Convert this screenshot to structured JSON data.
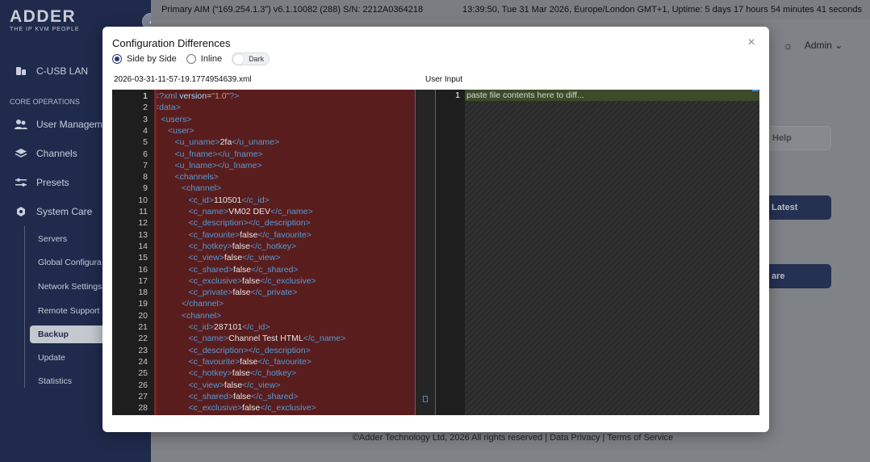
{
  "app": {
    "logo_name": "ADDER",
    "logo_tagline": "THE IP KVM PEOPLE",
    "status_left": "Primary AIM (“169.254.1.3”) v6.1.10082 (288) S/N: 2212A0364218",
    "status_right": "13:39:50, Tue 31 Mar 2026, Europe/London GMT+1, Uptime: 5 days 17 hours 54 minutes 41 seconds",
    "user_label": "Admin",
    "footer": "©Adder Technology Ltd, 2026 All rights reserved  |  Data Privacy  |  Terms of Service",
    "bg_button_1": "Help",
    "bg_button_2": "Latest",
    "bg_button_3": "are"
  },
  "sidebar": {
    "items": [
      {
        "label": "C-USB LAN",
        "icon": "usb-icon"
      },
      {
        "label": "User Managem",
        "icon": "users-icon"
      },
      {
        "label": "Channels",
        "icon": "layers-icon"
      },
      {
        "label": "Presets",
        "icon": "sliders-icon"
      },
      {
        "label": "System Care",
        "icon": "gear-icon"
      }
    ],
    "section_label": "CORE OPERATIONS",
    "sub_items": [
      "Servers",
      "Global Configura",
      "Network Settings",
      "Remote Support",
      "Backup",
      "Update",
      "Statistics"
    ]
  },
  "modal": {
    "title": "Configuration Differences",
    "options": {
      "side_by_side": "Side by Side",
      "inline": "Inline",
      "dark": "Dark"
    },
    "file_left": "2026-03-31-11-57-19.1774954639.xml",
    "file_right": "User Input",
    "right_line_number": "1",
    "right_placeholder": "paste file contents here to diff..."
  },
  "diff_lines": [
    {
      "n": "1",
      "i": 0,
      "h": "<span class=\"pi\">&lt;?xml</span> <span class=\"a\">version</span>=<span class=\"s\">\"1.0\"</span><span class=\"pi\">?&gt;</span>"
    },
    {
      "n": "2",
      "i": 0,
      "h": "<span class=\"t\">&lt;data&gt;</span>"
    },
    {
      "n": "3",
      "i": 1,
      "h": "<span class=\"t\">&lt;users&gt;</span>"
    },
    {
      "n": "4",
      "i": 2,
      "h": "<span class=\"t\">&lt;user&gt;</span>"
    },
    {
      "n": "5",
      "i": 3,
      "h": "<span class=\"t\">&lt;u_uname&gt;</span><span class=\"tx\">2fa</span><span class=\"t\">&lt;/u_uname&gt;</span>"
    },
    {
      "n": "6",
      "i": 3,
      "h": "<span class=\"t\">&lt;u_fname&gt;&lt;/u_fname&gt;</span>"
    },
    {
      "n": "7",
      "i": 3,
      "h": "<span class=\"t\">&lt;u_lname&gt;&lt;/u_lname&gt;</span>"
    },
    {
      "n": "8",
      "i": 3,
      "h": "<span class=\"t\">&lt;channels&gt;</span>"
    },
    {
      "n": "9",
      "i": 4,
      "h": "<span class=\"t\">&lt;channel&gt;</span>"
    },
    {
      "n": "10",
      "i": 5,
      "h": "<span class=\"t\">&lt;c_id&gt;</span><span class=\"tx\">110501</span><span class=\"t\">&lt;/c_id&gt;</span>"
    },
    {
      "n": "11",
      "i": 5,
      "h": "<span class=\"t\">&lt;c_name&gt;</span><span class=\"tx\">VM02 DEV</span><span class=\"t\">&lt;/c_name&gt;</span>"
    },
    {
      "n": "12",
      "i": 5,
      "h": "<span class=\"t\">&lt;c_description&gt;&lt;/c_description&gt;</span>"
    },
    {
      "n": "13",
      "i": 5,
      "h": "<span class=\"t\">&lt;c_favourite&gt;</span><span class=\"tx\">false</span><span class=\"t\">&lt;/c_favourite&gt;</span>"
    },
    {
      "n": "14",
      "i": 5,
      "h": "<span class=\"t\">&lt;c_hotkey&gt;</span><span class=\"tx\">false</span><span class=\"t\">&lt;/c_hotkey&gt;</span>"
    },
    {
      "n": "15",
      "i": 5,
      "h": "<span class=\"t\">&lt;c_view&gt;</span><span class=\"tx\">false</span><span class=\"t\">&lt;/c_view&gt;</span>"
    },
    {
      "n": "16",
      "i": 5,
      "h": "<span class=\"t\">&lt;c_shared&gt;</span><span class=\"tx\">false</span><span class=\"t\">&lt;/c_shared&gt;</span>"
    },
    {
      "n": "17",
      "i": 5,
      "h": "<span class=\"t\">&lt;c_exclusive&gt;</span><span class=\"tx\">false</span><span class=\"t\">&lt;/c_exclusive&gt;</span>"
    },
    {
      "n": "18",
      "i": 5,
      "h": "<span class=\"t\">&lt;c_private&gt;</span><span class=\"tx\">false</span><span class=\"t\">&lt;/c_private&gt;</span>"
    },
    {
      "n": "19",
      "i": 4,
      "h": "<span class=\"t\">&lt;/channel&gt;</span>"
    },
    {
      "n": "20",
      "i": 4,
      "h": "<span class=\"t\">&lt;channel&gt;</span>"
    },
    {
      "n": "21",
      "i": 5,
      "h": "<span class=\"t\">&lt;c_id&gt;</span><span class=\"tx\">287101</span><span class=\"t\">&lt;/c_id&gt;</span>"
    },
    {
      "n": "22",
      "i": 5,
      "h": "<span class=\"t\">&lt;c_name&gt;</span><span class=\"tx\">Channel Test HTML</span><span class=\"t\">&lt;/c_name&gt;</span>"
    },
    {
      "n": "23",
      "i": 5,
      "h": "<span class=\"t\">&lt;c_description&gt;&lt;/c_description&gt;</span>"
    },
    {
      "n": "24",
      "i": 5,
      "h": "<span class=\"t\">&lt;c_favourite&gt;</span><span class=\"tx\">false</span><span class=\"t\">&lt;/c_favourite&gt;</span>"
    },
    {
      "n": "25",
      "i": 5,
      "h": "<span class=\"t\">&lt;c_hotkey&gt;</span><span class=\"tx\">false</span><span class=\"t\">&lt;/c_hotkey&gt;</span>"
    },
    {
      "n": "26",
      "i": 5,
      "h": "<span class=\"t\">&lt;c_view&gt;</span><span class=\"tx\">false</span><span class=\"t\">&lt;/c_view&gt;</span>"
    },
    {
      "n": "27",
      "i": 5,
      "h": "<span class=\"t\">&lt;c_shared&gt;</span><span class=\"tx\">false</span><span class=\"t\">&lt;/c_shared&gt;</span>"
    },
    {
      "n": "28",
      "i": 5,
      "h": "<span class=\"t\">&lt;c_exclusive&gt;</span><span class=\"tx\">false</span><span class=\"t\">&lt;/c_exclusive&gt;</span>"
    }
  ]
}
